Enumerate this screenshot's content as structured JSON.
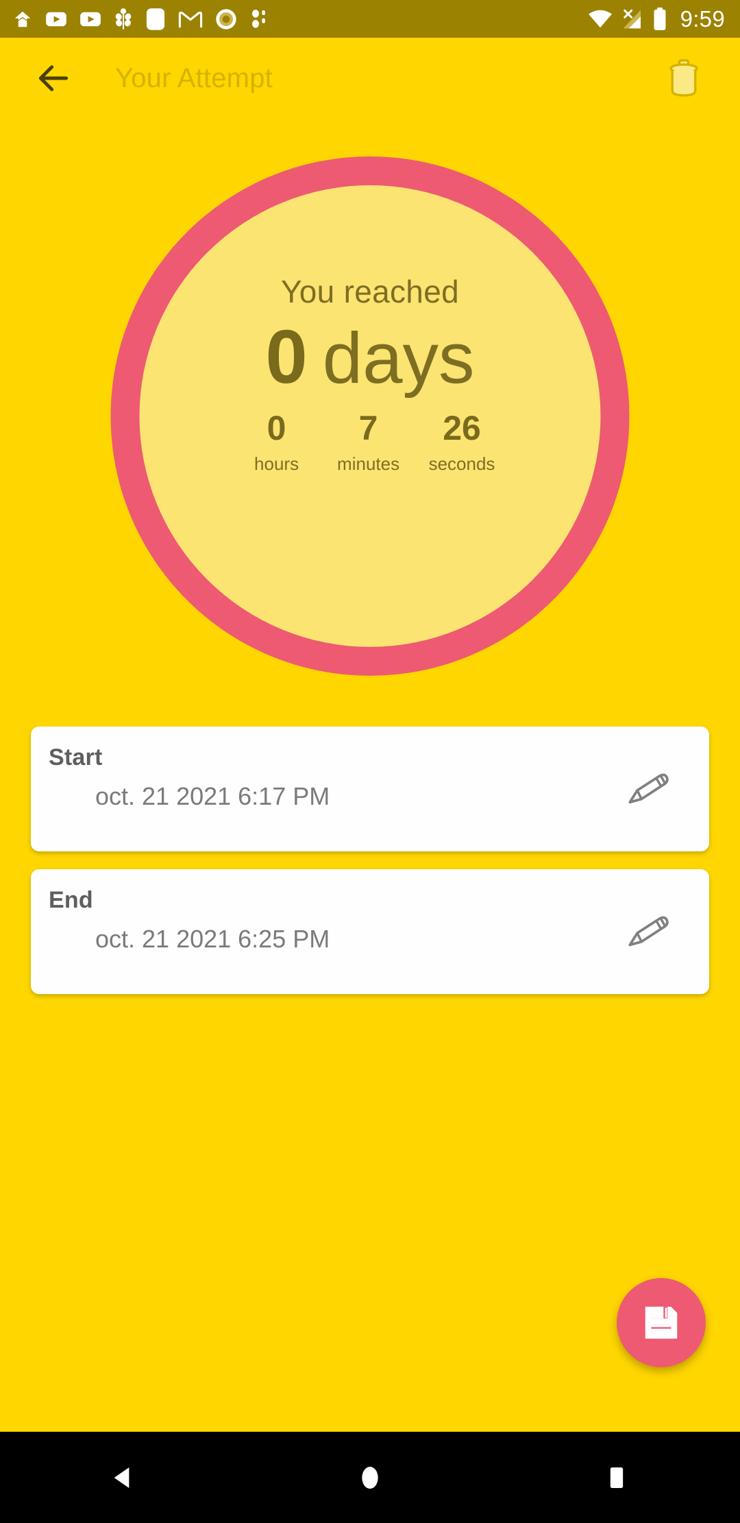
{
  "status_bar": {
    "background": "#9B8200",
    "clock": "9:59",
    "left_icons": [
      "upload-chevron-icon",
      "youtube-icon",
      "youtube-icon",
      "plant-icon",
      "rounded-square-app-icon",
      "gmail-icon",
      "record-circle-icon",
      "bluetooth-dots-icon"
    ],
    "right_icons": [
      "wifi-icon",
      "mobile-signal-off-icon",
      "battery-full-icon"
    ]
  },
  "app_bar": {
    "background": "#FFD600",
    "back_label": "back-arrow",
    "title": "Your Attempt",
    "title_color": "#D6B300",
    "delete_label": "trash-icon"
  },
  "circle": {
    "ring_color": "#EE5A72",
    "fill_color": "#FCE473",
    "text_color": "#7A6A1C",
    "reached_label": "You reached",
    "days_value": "0",
    "days_unit": "days",
    "units": [
      {
        "value": "0",
        "label": "hours"
      },
      {
        "value": "7",
        "label": "minutes"
      },
      {
        "value": "26",
        "label": "seconds"
      }
    ]
  },
  "cards": [
    {
      "title": "Start",
      "value": "oct. 21 2021 6:17 PM",
      "edit_icon": "pencil-icon"
    },
    {
      "title": "End",
      "value": "oct. 21 2021 6:25 PM",
      "edit_icon": "pencil-icon"
    }
  ],
  "fab": {
    "icon": "save-floppy-icon",
    "color": "#EE5A72"
  },
  "nav_bar": {
    "background": "#000000",
    "buttons": [
      "back-triangle-icon",
      "home-circle-icon",
      "recents-square-icon"
    ]
  }
}
